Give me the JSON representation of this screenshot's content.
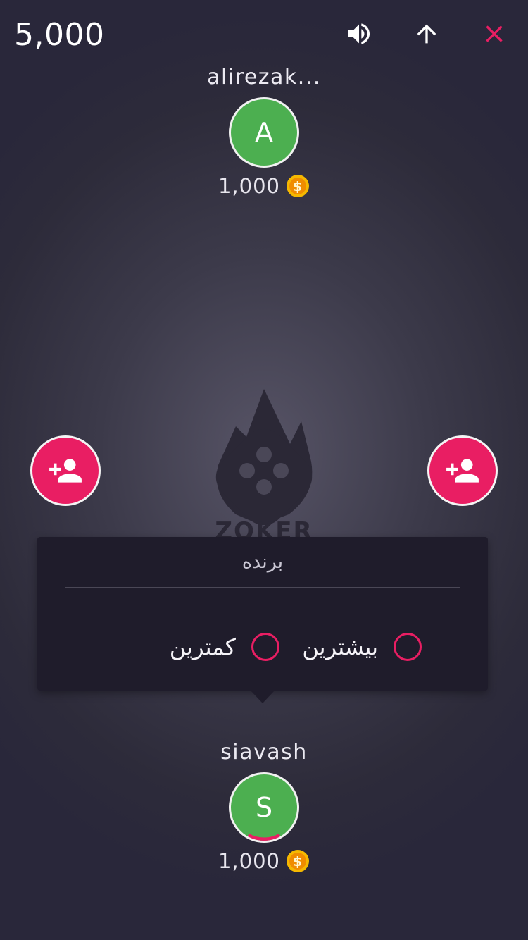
{
  "header": {
    "balance": "5,000",
    "sound_icon": "volume-icon",
    "up_icon": "arrow-up-icon",
    "close_icon": "close-icon",
    "close_color": "#e91e63"
  },
  "players": {
    "top": {
      "name": "alirezak...",
      "initial": "A",
      "coins": "1,000",
      "avatar_color": "#4caf50"
    },
    "bottom": {
      "name": "siavash",
      "initial": "S",
      "coins": "1,000",
      "avatar_color": "#4caf50"
    }
  },
  "add_player": {
    "icon": "person-add-icon",
    "color": "#e91e63"
  },
  "logo": {
    "text": "ZOKER"
  },
  "popup": {
    "title": "برنده",
    "options": [
      {
        "label": "بیشترین",
        "selected": false
      },
      {
        "label": "کمترین",
        "selected": false
      }
    ]
  },
  "colors": {
    "accent": "#e91e63",
    "coin": "#f5b800",
    "popup_bg": "#1f1c2b"
  }
}
